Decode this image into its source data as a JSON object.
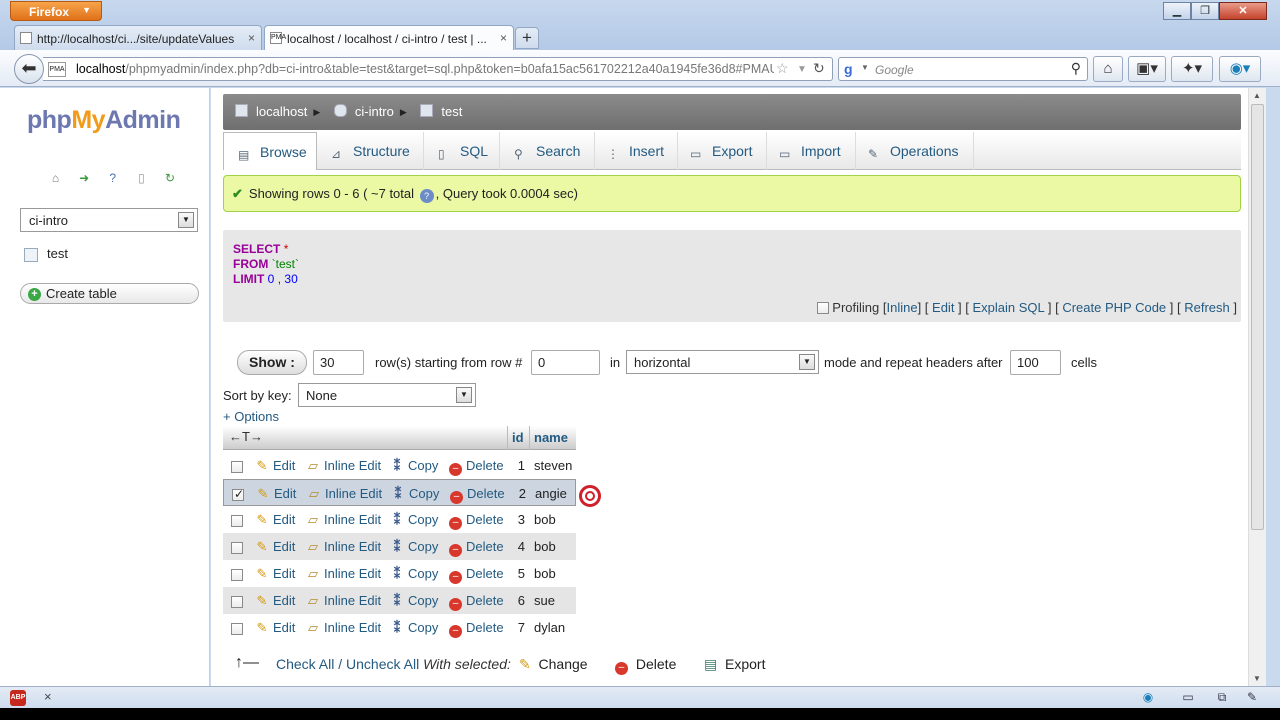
{
  "browser": {
    "menu_label": "Firefox",
    "tabs": [
      {
        "label": "http://localhost/ci.../site/updateValues"
      },
      {
        "label": "localhost / localhost / ci-intro / test | ..."
      }
    ],
    "url_host": "localhost",
    "url_path": "/phpmyadmin/index.php?db=ci-intro&table=test&target=sql.php&token=b0afa15ac561702212a40a1945fe36d8#PMAURL",
    "search_placeholder": "Google",
    "fav_text": "PMA"
  },
  "sidebar": {
    "logo_php": "php",
    "logo_my": "My",
    "logo_admin": "Admin",
    "db_selected": "ci-intro",
    "table": "test",
    "create_table": "Create table"
  },
  "breadcrumb": {
    "server": "localhost",
    "db": "ci-intro",
    "table": "test"
  },
  "tabs": {
    "browse": "Browse",
    "structure": "Structure",
    "sql": "SQL",
    "search": "Search",
    "insert": "Insert",
    "export": "Export",
    "import": "Import",
    "operations": "Operations"
  },
  "message": {
    "text1": "Showing rows 0 - 6 ( ~7 total",
    "text2": ", Query took 0.0004 sec)"
  },
  "sql": {
    "select": "SELECT",
    "star": "*",
    "from": "FROM",
    "table": "`test`",
    "limit": "LIMIT",
    "lim1": "0",
    "comma": ",",
    "lim2": "30"
  },
  "sql_links": {
    "profiling": "Profiling",
    "inline": "Inline",
    "edit": "Edit",
    "explain": "Explain SQL",
    "php": "Create PHP Code",
    "refresh": "Refresh"
  },
  "nav": {
    "show": "Show :",
    "rows": "30",
    "starting_label": "row(s) starting from row #",
    "start": "0",
    "in_label": "in",
    "mode": "horizontal",
    "repeat_label": "mode and repeat headers after",
    "repeat": "100",
    "cells_label": "cells",
    "sort_label": "Sort by key:",
    "sort_value": "None",
    "options": "+ Options"
  },
  "grid": {
    "arrows": "←T→",
    "col_id": "id",
    "col_name": "name",
    "edit": "Edit",
    "inline_edit": "Inline Edit",
    "copy": "Copy",
    "delete": "Delete",
    "rows": [
      {
        "id": "1",
        "name": "steven"
      },
      {
        "id": "2",
        "name": "angie"
      },
      {
        "id": "3",
        "name": "bob"
      },
      {
        "id": "4",
        "name": "bob"
      },
      {
        "id": "5",
        "name": "bob"
      },
      {
        "id": "6",
        "name": "sue"
      },
      {
        "id": "7",
        "name": "dylan"
      }
    ]
  },
  "footer": {
    "check_all": "Check All",
    "sep": "/",
    "uncheck_all": "Uncheck All",
    "with_selected": "With selected:",
    "change": "Change",
    "delete": "Delete",
    "export": "Export"
  },
  "statusbar": {
    "abp": "ABP",
    "close": "×"
  }
}
